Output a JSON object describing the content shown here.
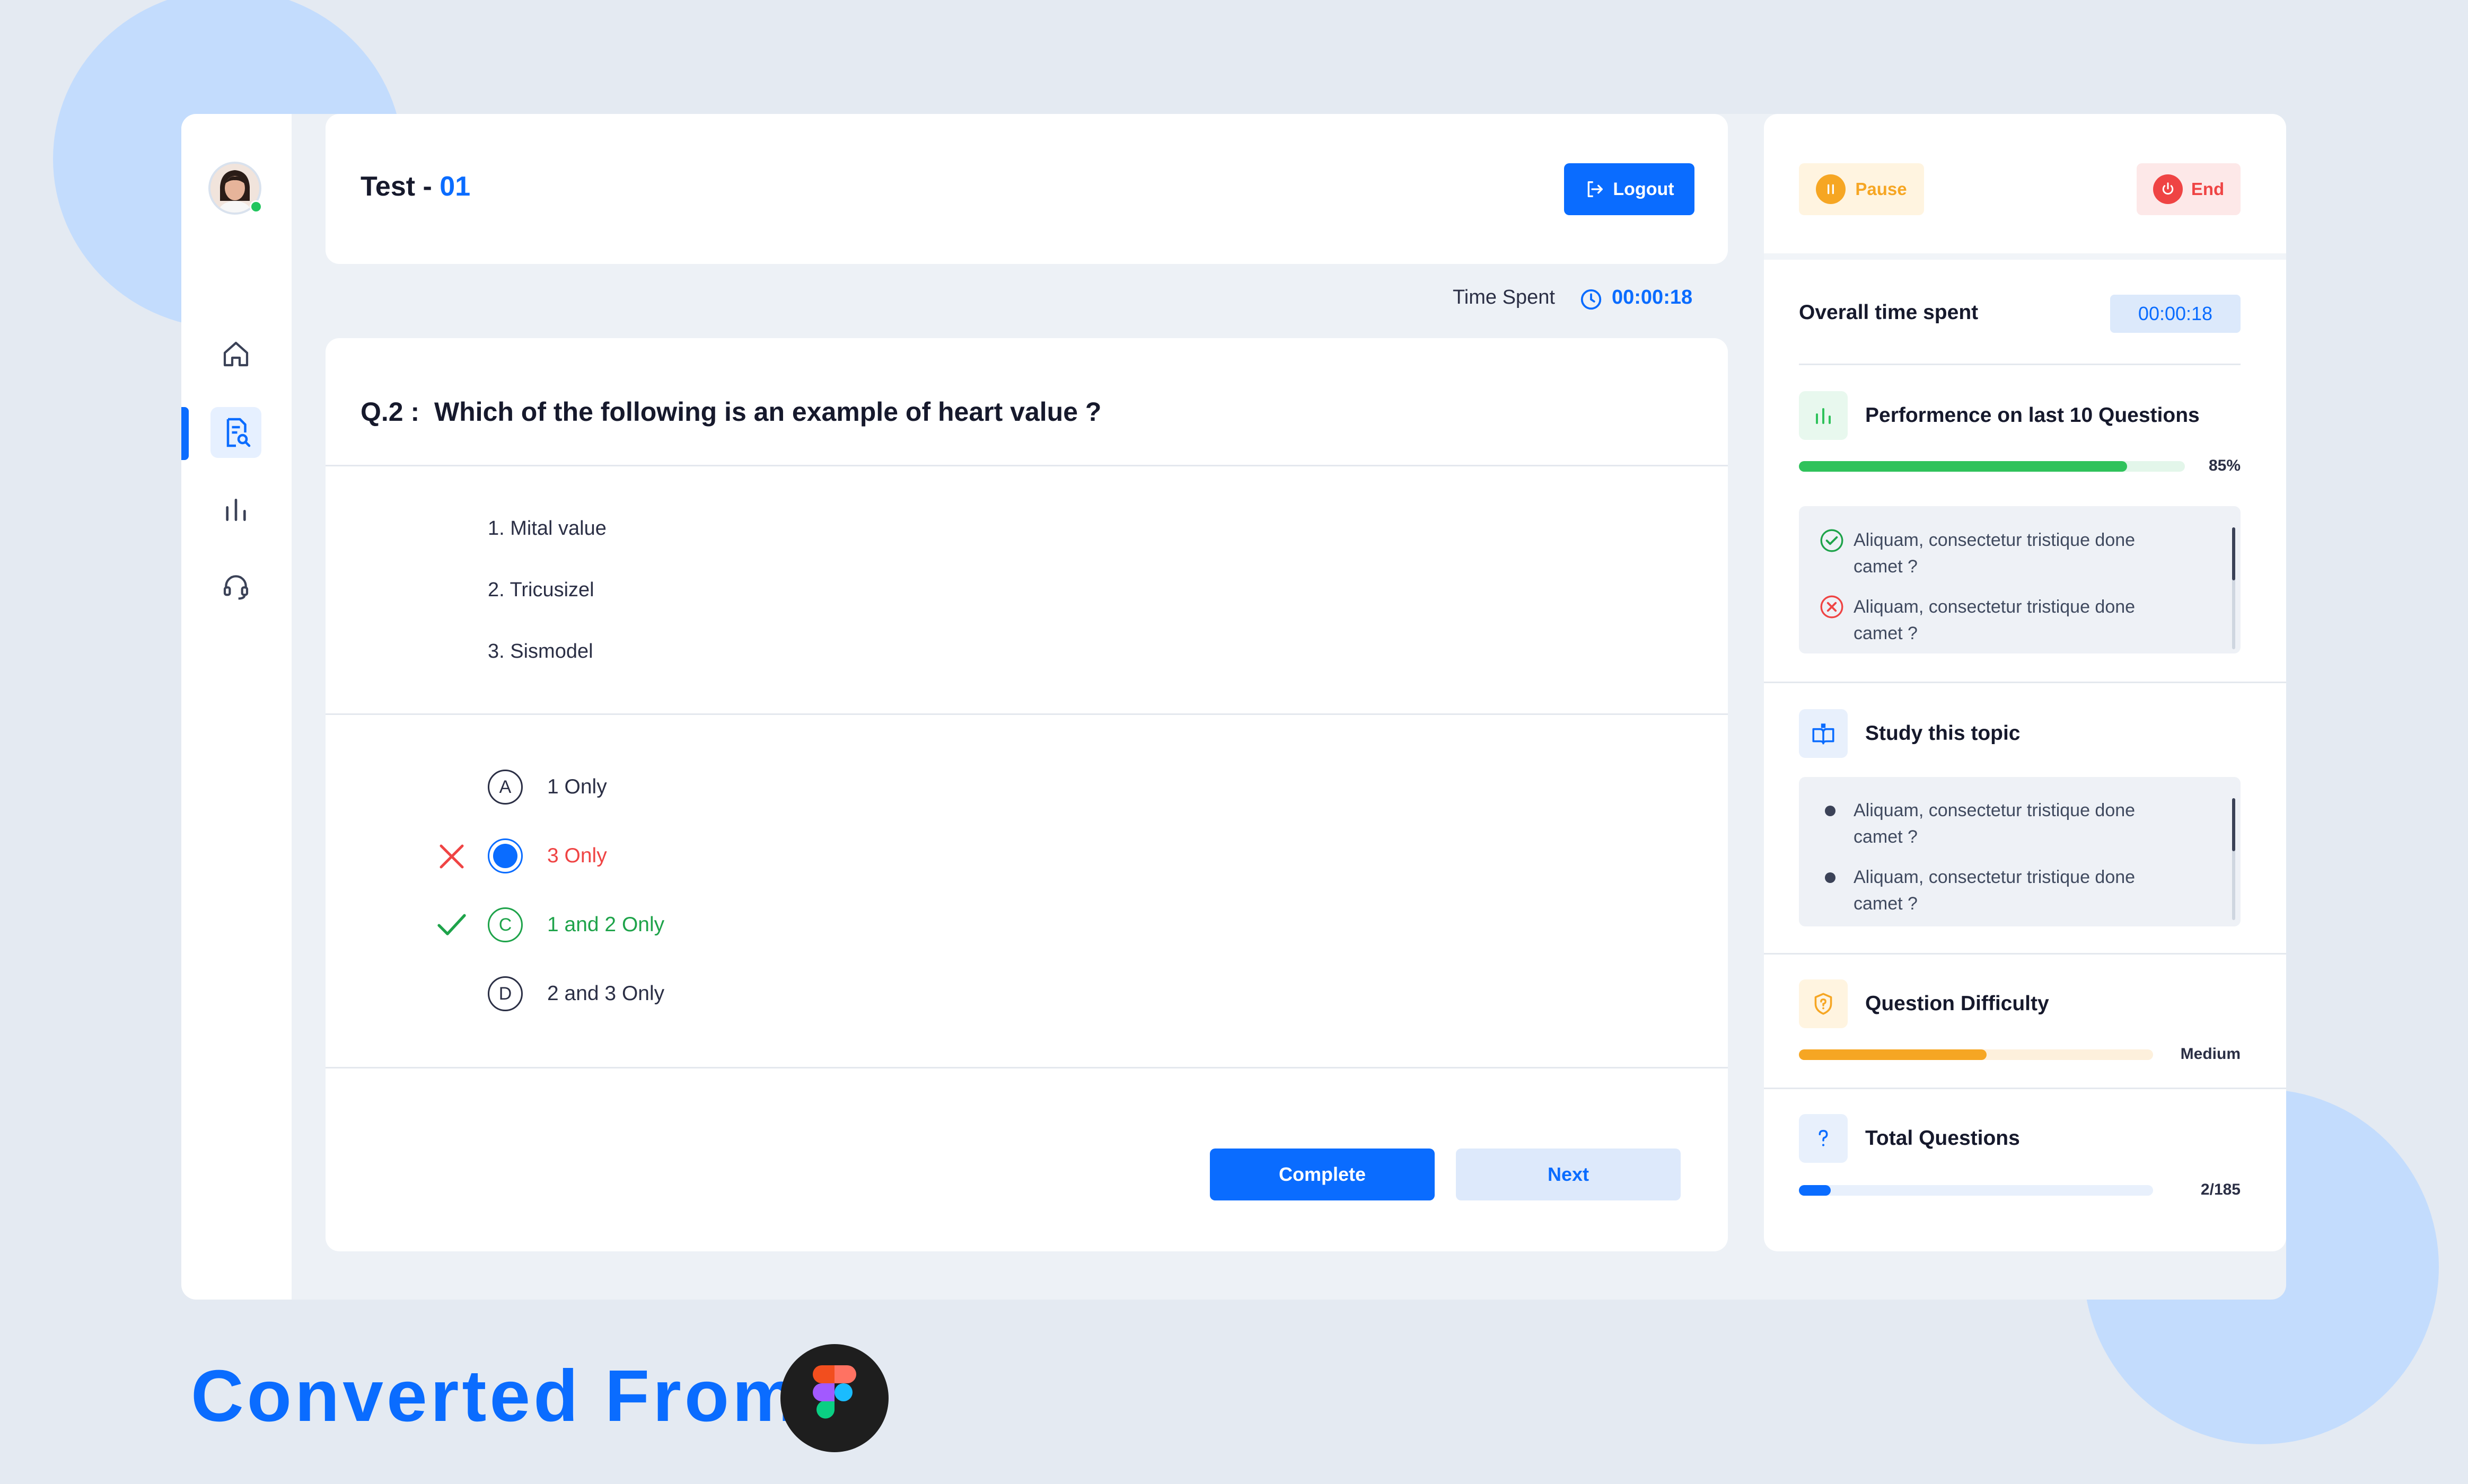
{
  "header": {
    "title_prefix": "Test - ",
    "title_number": "01",
    "logout_label": "Logout"
  },
  "timer": {
    "label": "Time Spent",
    "value": "00:00:18"
  },
  "question": {
    "prefix": "Q.2 :",
    "text": "Which of the following is an example of heart value ?",
    "statements": [
      "1. Mital value",
      "2. Tricusizel",
      "3. Sismodel"
    ],
    "options": [
      {
        "letter": "A",
        "label": "1 Only",
        "state": "neutral"
      },
      {
        "letter": "",
        "label": "3 Only",
        "state": "wrong-selected"
      },
      {
        "letter": "C",
        "label": "1 and 2 Only",
        "state": "correct"
      },
      {
        "letter": "D",
        "label": "2 and 3 Only",
        "state": "neutral"
      }
    ]
  },
  "actions": {
    "complete_label": "Complete",
    "next_label": "Next"
  },
  "controls": {
    "pause_label": "Pause",
    "end_label": "End"
  },
  "overall": {
    "label": "Overall time spent",
    "value": "00:00:18"
  },
  "performance": {
    "title": "Performence on last 10 Questions",
    "percent_label": "85%",
    "progress": 0.85,
    "items": [
      {
        "text_line1": "Aliquam, consectetur tristique done",
        "text_line2": "camet ?",
        "status": "correct"
      },
      {
        "text_line1": "Aliquam, consectetur tristique done",
        "text_line2": "camet ?",
        "status": "wrong"
      }
    ]
  },
  "study": {
    "title": "Study this topic",
    "items": [
      {
        "text_line1": "Aliquam, consectetur tristique done",
        "text_line2": "camet ?"
      },
      {
        "text_line1": "Aliquam, consectetur tristique done",
        "text_line2": "camet ?"
      }
    ]
  },
  "difficulty": {
    "title": "Question Difficulty",
    "label": "Medium",
    "level": 0.53
  },
  "total": {
    "title": "Total Questions",
    "label": "2/185",
    "progress": 0.09
  },
  "footer": {
    "text": "Converted From"
  },
  "colors": {
    "accent": "#0a6cff",
    "correct": "#1ea34a",
    "wrong": "#ef4444",
    "medium": "#f6a623",
    "perf": "#2fc25b"
  }
}
